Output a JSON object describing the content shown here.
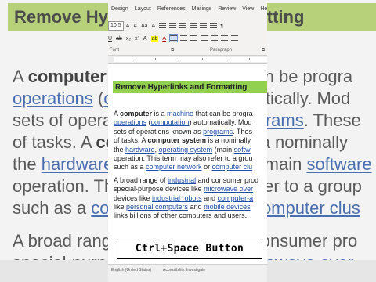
{
  "background": {
    "heading": "Remove Hyperlinks and Formatting",
    "lines": [
      [
        {
          "t": "A "
        },
        {
          "t": "computer",
          "b": 1
        },
        {
          "t": " is a "
        },
        {
          "t": "machine",
          "l": 1
        },
        {
          "t": " that can be progra"
        }
      ],
      [
        {
          "t": "operations",
          "l": 1
        },
        {
          "t": " ("
        },
        {
          "t": "computation",
          "l": 1
        },
        {
          "t": ") automatically. Mod"
        }
      ],
      [
        {
          "t": "sets of operations known as "
        },
        {
          "t": "programs",
          "l": 1
        },
        {
          "t": ". These"
        }
      ],
      [
        {
          "t": "of tasks. A "
        },
        {
          "t": "computer system",
          "b": 1
        },
        {
          "t": " is a nominally"
        }
      ],
      [
        {
          "t": "the "
        },
        {
          "t": "hardware",
          "l": 1
        },
        {
          "t": ", "
        },
        {
          "t": "operating system",
          "l": 1
        },
        {
          "t": " (main "
        },
        {
          "t": "software",
          "l": 1
        }
      ],
      [
        {
          "t": "operation. This term may also refer to a group"
        }
      ],
      [
        {
          "t": "such as a "
        },
        {
          "t": "computer network",
          "l": 1
        },
        {
          "t": " or "
        },
        {
          "t": "computer clus",
          "l": 1
        }
      ],
      [],
      [
        {
          "t": "A broad range of "
        },
        {
          "t": "industrial",
          "l": 1
        },
        {
          "t": " and consumer pro"
        }
      ],
      [
        {
          "t": "special-purpose devices like "
        },
        {
          "t": "microwave over",
          "l": 1
        }
      ],
      [
        {
          "t": "devices like "
        },
        {
          "t": "industrial robots",
          "l": 1
        },
        {
          "t": " and "
        },
        {
          "t": "computer-a",
          "l": 1
        }
      ]
    ]
  },
  "ribbon": {
    "tabs": [
      "Design",
      "Layout",
      "References",
      "Mailings",
      "Review",
      "View",
      "He"
    ],
    "font_size": "10.5",
    "grow_font": "A",
    "shrink_font": "A",
    "case_button": "Aa",
    "clear_format": "A",
    "underline_label": "U",
    "strike_label": "ab",
    "subscript_label": "x₂",
    "superscript_label": "x²",
    "text_effects": "A",
    "highlight_label": "ab",
    "font_color_label": "A",
    "group_font": "Font",
    "group_paragraph": "Paragraph"
  },
  "document": {
    "heading": "Remove Hyperlinks and Formatting",
    "paragraphs": [
      [
        [
          {
            "t": "A "
          },
          {
            "t": "computer",
            "b": 1
          },
          {
            "t": " is a "
          },
          {
            "t": "machine",
            "l": 1
          },
          {
            "t": " that can be progra"
          }
        ],
        [
          {
            "t": "operations",
            "l": 1
          },
          {
            "t": " ("
          },
          {
            "t": "computation",
            "l": 1
          },
          {
            "t": ") automatically. Mod"
          }
        ],
        [
          {
            "t": "sets of operations known as "
          },
          {
            "t": "programs",
            "l": 1
          },
          {
            "t": ". Thes"
          }
        ],
        [
          {
            "t": "of tasks. A "
          },
          {
            "t": "computer system",
            "b": 1
          },
          {
            "t": " is a nominally"
          }
        ],
        [
          {
            "t": "the "
          },
          {
            "t": "hardware",
            "l": 1
          },
          {
            "t": ", "
          },
          {
            "t": "operating system",
            "l": 1
          },
          {
            "t": " (main "
          },
          {
            "t": "softw",
            "l": 1
          }
        ],
        [
          {
            "t": "operation. This term may also refer to a grou"
          }
        ],
        [
          {
            "t": "such as a "
          },
          {
            "t": "computer network",
            "l": 1
          },
          {
            "t": " or "
          },
          {
            "t": "computer clu",
            "l": 1
          }
        ]
      ],
      [
        [
          {
            "t": "A broad range of "
          },
          {
            "t": "industrial",
            "l": 1
          },
          {
            "t": " and consumer prod"
          }
        ],
        [
          {
            "t": "special-purpose devices like "
          },
          {
            "t": "microwave over",
            "l": 1
          }
        ],
        [
          {
            "t": "devices like "
          },
          {
            "t": "industrial robots",
            "l": 1
          },
          {
            "t": " and "
          },
          {
            "t": "computer-a",
            "l": 1
          }
        ],
        [
          {
            "t": "like "
          },
          {
            "t": "personal computers",
            "l": 1
          },
          {
            "t": " and "
          },
          {
            "t": "mobile devices",
            "l": 1
          }
        ],
        [
          {
            "t": "links billions of other computers and users."
          }
        ]
      ]
    ]
  },
  "caption": "Ctrl+Space Button",
  "status_bar": {
    "language": "English (United States)",
    "accessibility": "Accessibility: Investigate"
  },
  "colors": {
    "heading_highlight": "#92d050",
    "hyperlink": "#1f4fa8",
    "ribbon_bg": "#f3f2f1"
  }
}
